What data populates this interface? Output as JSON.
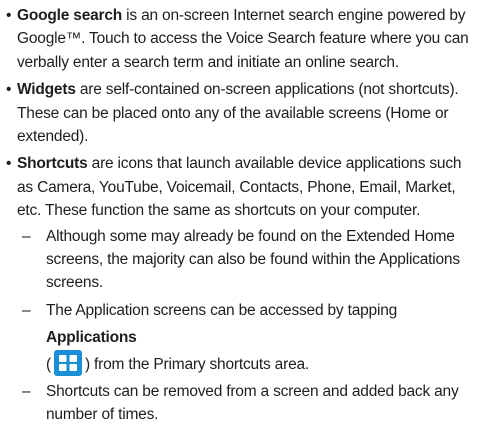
{
  "bullet_symbol": "•",
  "dash_symbol": "–",
  "items": [
    {
      "term": "Google search",
      "text": " is an on-screen Internet search engine powered by Google™. Touch to access the Voice Search feature where you can verbally enter a search term and initiate an online search."
    },
    {
      "term": "Widgets",
      "text": " are self-contained on-screen applications (not shortcuts). These can be placed onto any of the available screens (Home or extended)."
    },
    {
      "term": "Shortcuts",
      "text": " are icons that launch available device applications such as Camera, YouTube, Voicemail, Contacts, Phone, Email, Market, etc. These function the same as shortcuts on your computer."
    }
  ],
  "sub_items": {
    "first": "Although some may already be found on the Extended Home screens, the majority can also be found within the Applications screens.",
    "second_before": "The Application screens can be accessed by tapping ",
    "second_term": "Applications",
    "second_paren_open": "(",
    "second_after": ") from the Primary shortcuts area.",
    "third": "Shortcuts can be removed from a screen and added back any number of times."
  },
  "icon": {
    "name": "applications-grid-icon",
    "color": "#1a8fd6",
    "tile_color": "#ffffff"
  }
}
